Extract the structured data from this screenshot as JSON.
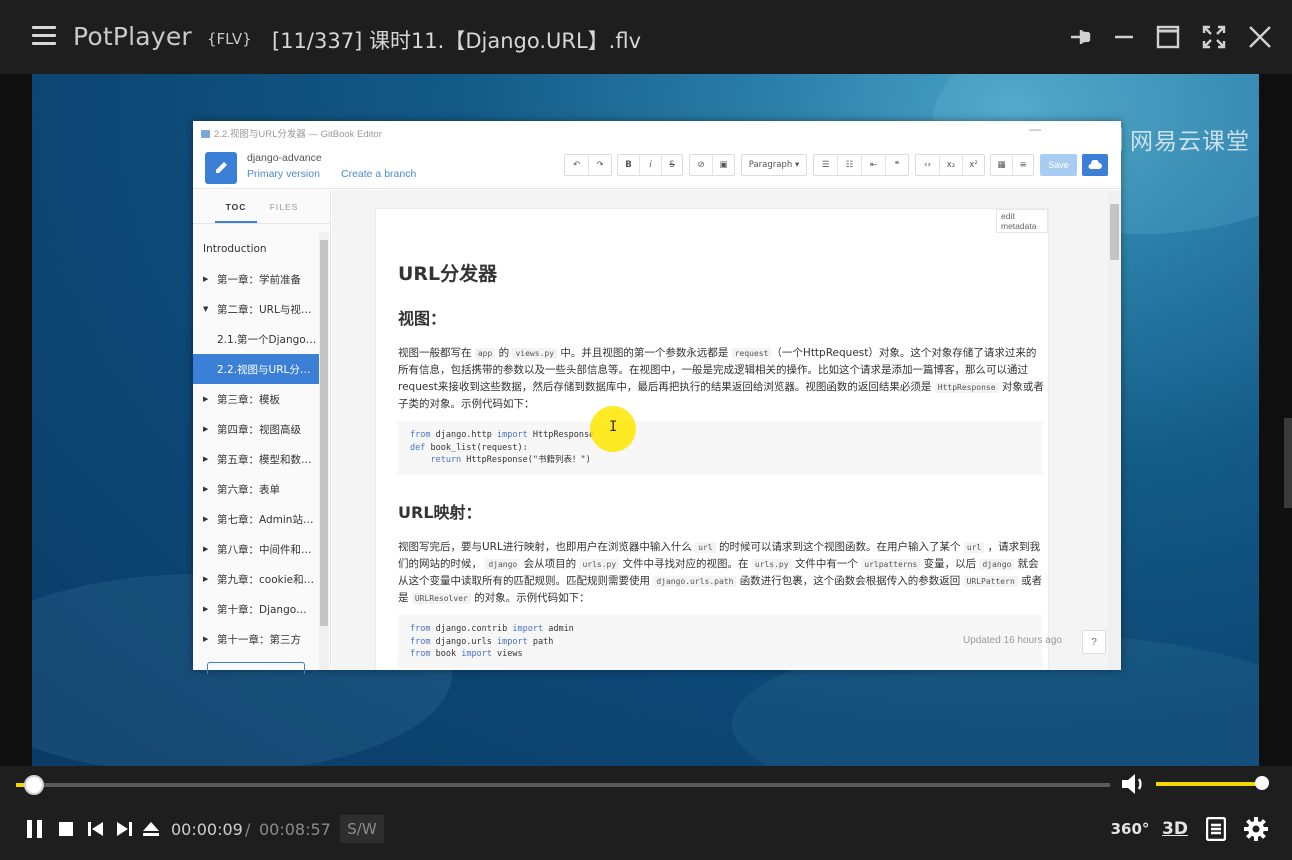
{
  "window": {
    "app_name": "PotPlayer",
    "format_badge": "{FLV}",
    "file_title": "[11/337] 课时11.【Django.URL】.flv"
  },
  "watermark": {
    "text": "网易云课堂"
  },
  "gitbook": {
    "window_title": "2.2.视图与URL分发器 — GitBook Editor",
    "book_name": "django-advance",
    "version_label": "Primary version",
    "branch_label": "Create a branch",
    "paragraph_select": "Paragraph ▾",
    "save_label": "Save",
    "tabs": {
      "toc": "TOC",
      "files": "FILES"
    },
    "toc": [
      {
        "label": "Introduction",
        "level": 0,
        "arrow": ""
      },
      {
        "label": "第一章：学前准备",
        "level": 0,
        "arrow": "▶"
      },
      {
        "label": "第二章：URL与视…",
        "level": 0,
        "arrow": "▼"
      },
      {
        "label": "2.1.第一个Django…",
        "level": 1,
        "arrow": ""
      },
      {
        "label": "2.2.视图与URL分…",
        "level": 1,
        "arrow": "",
        "active": true
      },
      {
        "label": "第三章：模板",
        "level": 0,
        "arrow": "▶"
      },
      {
        "label": "第四章：视图高级",
        "level": 0,
        "arrow": "▶"
      },
      {
        "label": "第五章：模型和数…",
        "level": 0,
        "arrow": "▶"
      },
      {
        "label": "第六章：表单",
        "level": 0,
        "arrow": "▶"
      },
      {
        "label": "第七章：Admin站…",
        "level": 0,
        "arrow": "▶"
      },
      {
        "label": "第八章：中间件和…",
        "level": 0,
        "arrow": "▶"
      },
      {
        "label": "第九章：cookie和…",
        "level": 0,
        "arrow": "▶"
      },
      {
        "label": "第十章：Django…",
        "level": 0,
        "arrow": "▶"
      },
      {
        "label": "第十一章：第三方",
        "level": 0,
        "arrow": "▶"
      }
    ],
    "content": {
      "edit_metadata": "edit metadata",
      "h1": "URL分发器",
      "h2_view": "视图：",
      "para1_a": "视图一般都写在 ",
      "para1_code1": "app",
      "para1_b": " 的 ",
      "para1_code2": "views.py",
      "para1_c": " 中。并且视图的第一个参数永远都是 ",
      "para1_code3": "request",
      "para1_d": "（一个HttpRequest）对象。这个对象存储了请求过来的所有信息，包括携带的参数以及一些头部信息等。在视图中，一般是完成逻辑相关的操作。比如这个请求是添加一篇博客，那么可以通过request来接收到这些数据，然后存储到数据库中，最后再把执行的结果返回给浏览器。视图函数的返回结果必须是 ",
      "para1_code4": "HttpResponse",
      "para1_e": " 对象或者子类的对象。示例代码如下：",
      "code1": [
        {
          "kw": "from",
          "rest": " django.http ",
          "kw2": "import",
          "rest2": " HttpResponse"
        },
        {
          "kw": "def",
          "rest": " book_list(request):",
          "kw2": "",
          "rest2": ""
        },
        {
          "kw": "    return",
          "rest": " HttpResponse(\"书籍列表！\")",
          "kw2": "",
          "rest2": ""
        }
      ],
      "h2_url": "URL映射：",
      "para2_a": "视图写完后，要与URL进行映射，也即用户在浏览器中输入什么 ",
      "para2_code1": "url",
      "para2_b": " 的时候可以请求到这个视图函数。在用户输入了某个 ",
      "para2_code2": "url",
      "para2_c": " ，请求到我们的网站的时候， ",
      "para2_code3": "django",
      "para2_d": " 会从项目的 ",
      "para2_code4": "urls.py",
      "para2_e": " 文件中寻找对应的视图。在 ",
      "para2_code5": "urls.py",
      "para2_f": " 文件中有一个 ",
      "para2_code6": "urlpatterns",
      "para2_g": " 变量，以后 ",
      "para2_code7": "django",
      "para2_h": " 就会从这个变量中读取所有的匹配规则。匹配规则需要使用 ",
      "para2_code8": "django.urls.path",
      "para2_i": " 函数进行包裹，这个函数会根据传入的参数返回 ",
      "para2_code9": "URLPattern",
      "para2_j": " 或者是 ",
      "para2_code10": "URLResolver",
      "para2_k": " 的对象。示例代码如下：",
      "code2": [
        {
          "kw": "from",
          "rest": " django.contrib ",
          "kw2": "import",
          "rest2": " admin"
        },
        {
          "kw": "from",
          "rest": " django.urls ",
          "kw2": "import",
          "rest2": " path"
        },
        {
          "kw": "from",
          "rest": " book ",
          "kw2": "import",
          "rest2": " views"
        }
      ]
    },
    "updated_text": "Updated 16 hours ago",
    "help_label": "?"
  },
  "player": {
    "current_time": "00:00:09",
    "separator": "/",
    "total_time": "00:08:57",
    "sw_label": "S/W",
    "seek_progress": 0.0168,
    "volume_level": 1.0,
    "btn_360": "360°",
    "btn_3d": "3D"
  },
  "colors": {
    "accent": "#f5d800",
    "gitbook_blue": "#3b7fd6"
  }
}
